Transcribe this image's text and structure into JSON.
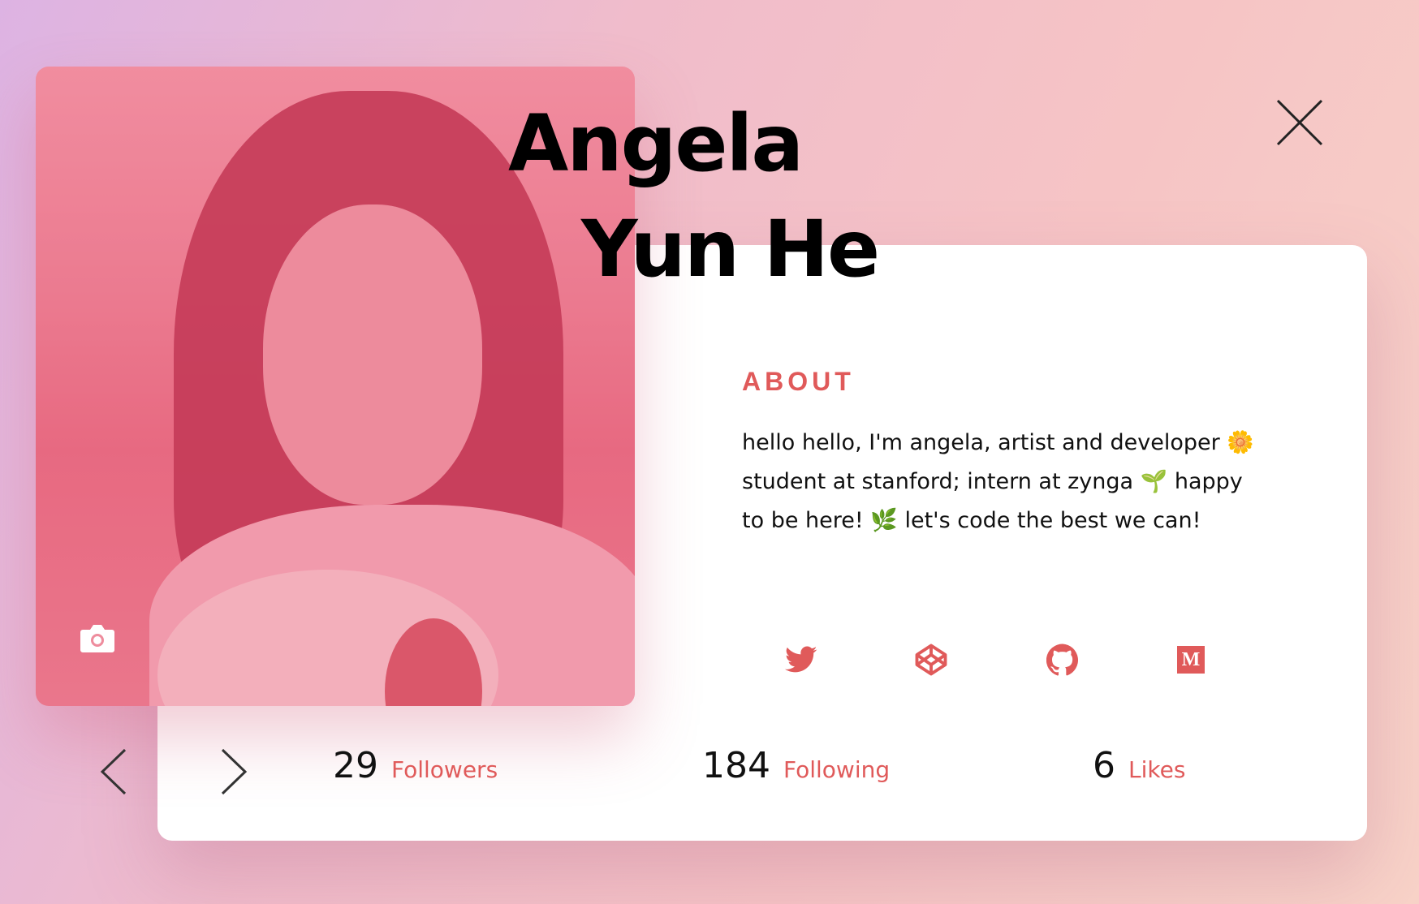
{
  "profile": {
    "name_line1": "Angela",
    "name_line2": "Yun He"
  },
  "about": {
    "heading": "ABOUT",
    "text": "hello hello, I'm angela, artist and developer 🌼  student at stanford; intern at zynga 🌱 happy to be here! 🌿  let's code the best we can!"
  },
  "social": [
    {
      "icon": "twitter-icon"
    },
    {
      "icon": "codepen-icon"
    },
    {
      "icon": "github-icon"
    },
    {
      "icon": "medium-icon",
      "glyph": "M"
    }
  ],
  "stats": [
    {
      "value": "29",
      "label": "Followers"
    },
    {
      "value": "184",
      "label": "Following"
    },
    {
      "value": "6",
      "label": "Likes"
    }
  ],
  "colors": {
    "accent": "#e05a5a",
    "text": "#111111",
    "card": "#ffffff"
  }
}
